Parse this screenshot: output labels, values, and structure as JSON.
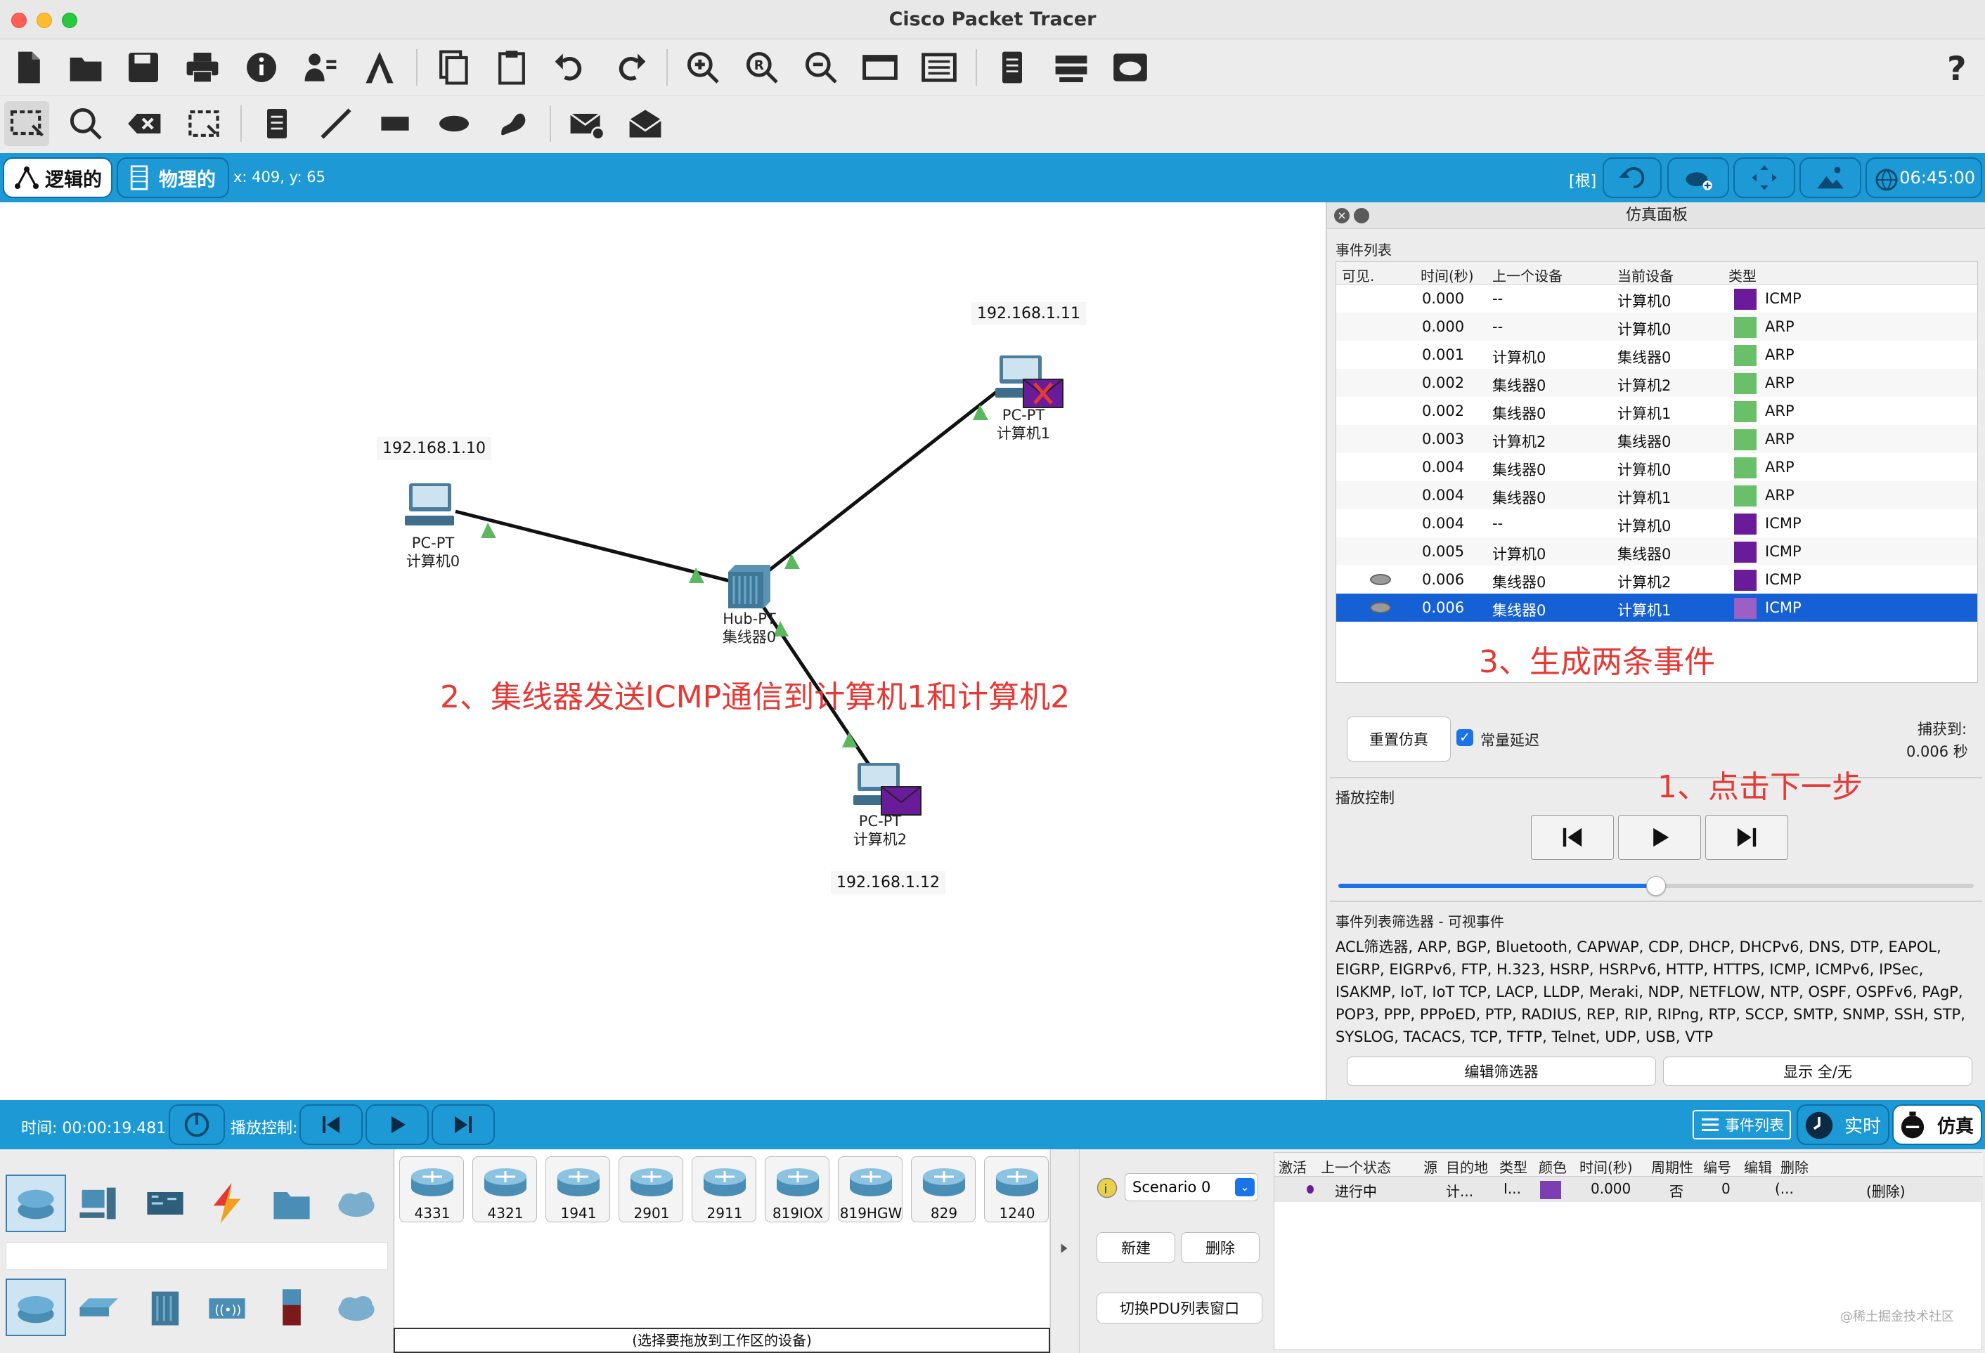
{
  "window": {
    "title": "Cisco Packet Tracer"
  },
  "modebar": {
    "logical_tab": "逻辑的",
    "physical_tab": "物理的",
    "coords": "x: 409, y: 65",
    "root": "[根]",
    "clock": "06:45:00"
  },
  "workspace": {
    "devices": [
      {
        "id": "pc0",
        "type": "PC-PT",
        "name": "计算机0",
        "ip": "192.168.1.10"
      },
      {
        "id": "pc1",
        "type": "PC-PT",
        "name": "计算机1",
        "ip": "192.168.1.11"
      },
      {
        "id": "pc2",
        "type": "PC-PT",
        "name": "计算机2",
        "ip": "192.168.1.12"
      },
      {
        "id": "hub0",
        "type": "Hub-PT",
        "name": "集线器0"
      }
    ],
    "annotations": {
      "step2": "2、集线器发送ICMP通信到计算机1和计算机2",
      "step3": "3、生成两条事件",
      "step1": "1、点击下一步"
    }
  },
  "sim_panel": {
    "title": "仿真面板",
    "event_list_label": "事件列表",
    "columns": [
      "可见.",
      "时间(秒)",
      "上一个设备",
      "当前设备",
      "类型"
    ],
    "events": [
      {
        "visible": false,
        "time": "0.000",
        "last": "--",
        "current": "计算机0",
        "type": "ICMP",
        "color": "#6a1b9a"
      },
      {
        "visible": false,
        "time": "0.000",
        "last": "--",
        "current": "计算机0",
        "type": "ARP",
        "color": "#6abf69"
      },
      {
        "visible": false,
        "time": "0.001",
        "last": "计算机0",
        "current": "集线器0",
        "type": "ARP",
        "color": "#6abf69"
      },
      {
        "visible": false,
        "time": "0.002",
        "last": "集线器0",
        "current": "计算机2",
        "type": "ARP",
        "color": "#6abf69"
      },
      {
        "visible": false,
        "time": "0.002",
        "last": "集线器0",
        "current": "计算机1",
        "type": "ARP",
        "color": "#6abf69"
      },
      {
        "visible": false,
        "time": "0.003",
        "last": "计算机2",
        "current": "集线器0",
        "type": "ARP",
        "color": "#6abf69"
      },
      {
        "visible": false,
        "time": "0.004",
        "last": "集线器0",
        "current": "计算机0",
        "type": "ARP",
        "color": "#6abf69"
      },
      {
        "visible": false,
        "time": "0.004",
        "last": "集线器0",
        "current": "计算机1",
        "type": "ARP",
        "color": "#6abf69"
      },
      {
        "visible": false,
        "time": "0.004",
        "last": "--",
        "current": "计算机0",
        "type": "ICMP",
        "color": "#6a1b9a"
      },
      {
        "visible": false,
        "time": "0.005",
        "last": "计算机0",
        "current": "集线器0",
        "type": "ICMP",
        "color": "#6a1b9a"
      },
      {
        "visible": true,
        "time": "0.006",
        "last": "集线器0",
        "current": "计算机2",
        "type": "ICMP",
        "color": "#6a1b9a"
      },
      {
        "visible": true,
        "time": "0.006",
        "last": "集线器0",
        "current": "计算机1",
        "type": "ICMP",
        "color": "#9c5fc4",
        "selected": true
      }
    ],
    "reset_button": "重置仿真",
    "const_delay_label": "常量延迟",
    "const_delay_checked": true,
    "captured_label": "捕获到:",
    "captured_value": "0.006 秒",
    "playback_label": "播放控制",
    "playback_progress": 0.5,
    "filter_label": "事件列表筛选器 - 可视事件",
    "filter_text": "ACL筛选器, ARP, BGP, Bluetooth, CAPWAP, CDP, DHCP, DHCPv6, DNS, DTP, EAPOL, EIGRP, EIGRPv6, FTP, H.323, HSRP, HSRPv6, HTTP, HTTPS, ICMP, ICMPv6, IPSec, ISAKMP, IoT, IoT TCP, LACP, LLDP, Meraki, NDP, NETFLOW, NTP, OSPF, OSPFv6, PAgP, POP3, PPP, PPPoED, PTP, RADIUS, REP, RIP, RIPng, RTP, SCCP, SMTP, SNMP, SSH, STP, SYSLOG, TACACS, TCP, TFTP, Telnet, UDP, USB, VTP",
    "edit_filter_button": "编辑筛选器",
    "show_all_button": "显示 全/无"
  },
  "bottombar": {
    "time": "时间: 00:00:19.481",
    "playback_label": "播放控制:",
    "event_list_button": "事件列表",
    "realtime_button": "实时",
    "simulation_button": "仿真"
  },
  "palette": {
    "device_models": [
      "4331",
      "4321",
      "1941",
      "2901",
      "2911",
      "819IOX",
      "819HGW",
      "829",
      "1240"
    ],
    "hint": "(选择要拖放到工作区的设备)"
  },
  "scenario": {
    "selected": "Scenario 0",
    "new_button": "新建",
    "delete_button": "删除",
    "toggle_button": "切换PDU列表窗口"
  },
  "pdu_table": {
    "columns": [
      "激活",
      "上一个状态",
      "源",
      "目的地",
      "类型",
      "颜色",
      "时间(秒)",
      "周期性",
      "编号",
      "编辑",
      "删除"
    ],
    "row": {
      "state": "进行中",
      "src": "计...",
      "dst": "I...",
      "color": "#7b3fb3",
      "time": "0.000",
      "periodic": "否",
      "num": "0",
      "edit": "(...",
      "delete": "(删除)"
    }
  },
  "watermark": "@稀土掘金技术社区"
}
